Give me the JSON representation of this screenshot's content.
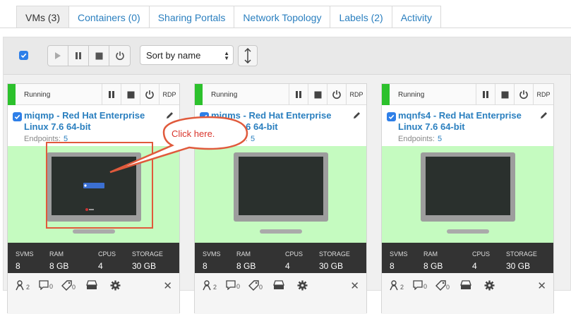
{
  "tabs": [
    {
      "label": "VMs (3)",
      "active": true
    },
    {
      "label": "Containers (0)"
    },
    {
      "label": "Sharing Portals"
    },
    {
      "label": "Network Topology"
    },
    {
      "label": "Labels (2)"
    },
    {
      "label": "Activity"
    }
  ],
  "toolbar": {
    "sort_label": "Sort by name",
    "icons": [
      "play-icon",
      "pause-icon",
      "stop-icon",
      "power-icon",
      "sort-direction-icon"
    ]
  },
  "stat_labels": {
    "svms": "SVMS",
    "ram": "RAM",
    "cpus": "CPUS",
    "storage": "STORAGE"
  },
  "vms": [
    {
      "status": "Running",
      "rdp": "RDP",
      "name": "miqmp - Red Hat Enterprise Linux 7.6 64-bit",
      "endpoints_label": "Endpoints:",
      "endpoints": "5",
      "svms": "8",
      "ram": "8 GB",
      "cpus": "4",
      "storage": "30 GB",
      "users": "2",
      "comments": "0",
      "tags": "0"
    },
    {
      "status": "Running",
      "rdp": "RDP",
      "name": "miqms - Red Hat Enterprise Linux 7.6 64-bit",
      "endpoints_label": "Endpoints:",
      "endpoints": "5",
      "svms": "8",
      "ram": "8 GB",
      "cpus": "4",
      "storage": "30 GB",
      "users": "2",
      "comments": "0",
      "tags": "0"
    },
    {
      "status": "Running",
      "rdp": "RDP",
      "name": "mqnfs4 - Red Hat Enterprise Linux 7.6 64-bit",
      "endpoints_label": "Endpoints:",
      "endpoints": "5",
      "svms": "8",
      "ram": "8 GB",
      "cpus": "4",
      "storage": "30 GB",
      "users": "2",
      "comments": "0",
      "tags": "0"
    }
  ],
  "annotation": {
    "text": "Click here.",
    "color": "#d9342b"
  },
  "colors": {
    "accent": "#2a7fbf",
    "running": "#2cc12c",
    "screen_bg": "#c5fbc0",
    "checkbox": "#2e7fe8"
  }
}
